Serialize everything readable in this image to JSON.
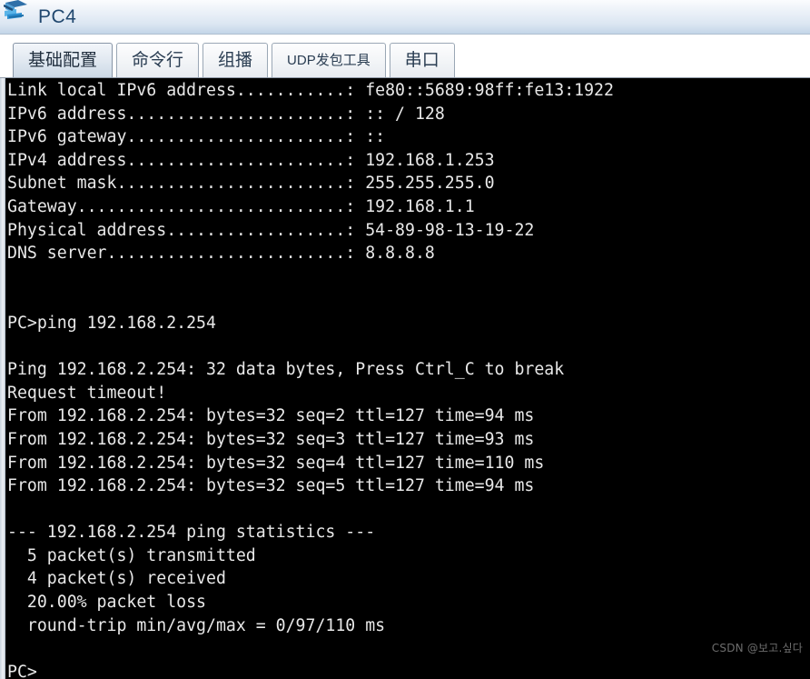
{
  "window": {
    "title": "PC4",
    "icon": "pc-device-icon"
  },
  "tabs": [
    {
      "label": "基础配置",
      "active": true,
      "small": false,
      "name": "tab-basic-config"
    },
    {
      "label": "命令行",
      "active": false,
      "small": false,
      "name": "tab-command-line"
    },
    {
      "label": "组播",
      "active": false,
      "small": false,
      "name": "tab-multicast"
    },
    {
      "label": "UDP发包工具",
      "active": false,
      "small": true,
      "name": "tab-udp-packet-tool"
    },
    {
      "label": "串口",
      "active": false,
      "small": false,
      "name": "tab-serial-port"
    }
  ],
  "terminal": {
    "prompt": "PC>",
    "lines": [
      "Link local IPv6 address...........: fe80::5689:98ff:fe13:1922",
      "IPv6 address......................: :: / 128",
      "IPv6 gateway......................: ::",
      "IPv4 address......................: 192.168.1.253",
      "Subnet mask.......................: 255.255.255.0",
      "Gateway...........................: 192.168.1.1",
      "Physical address..................: 54-89-98-13-19-22",
      "DNS server........................: 8.8.8.8",
      "",
      "",
      "PC>ping 192.168.2.254",
      "",
      "Ping 192.168.2.254: 32 data bytes, Press Ctrl_C to break",
      "Request timeout!",
      "From 192.168.2.254: bytes=32 seq=2 ttl=127 time=94 ms",
      "From 192.168.2.254: bytes=32 seq=3 ttl=127 time=93 ms",
      "From 192.168.2.254: bytes=32 seq=4 ttl=127 time=110 ms",
      "From 192.168.2.254: bytes=32 seq=5 ttl=127 time=94 ms",
      "",
      "--- 192.168.2.254 ping statistics ---",
      "  5 packet(s) transmitted",
      "  4 packet(s) received",
      "  20.00% packet loss",
      "  round-trip min/avg/max = 0/97/110 ms",
      "",
      "PC>"
    ],
    "config": {
      "link_local_ipv6": "fe80::5689:98ff:fe13:1922",
      "ipv6_address": ":: / 128",
      "ipv6_gateway": "::",
      "ipv4_address": "192.168.1.253",
      "subnet_mask": "255.255.255.0",
      "gateway": "192.168.1.1",
      "physical_address": "54-89-98-13-19-22",
      "dns_server": "8.8.8.8"
    },
    "ping": {
      "command": "ping 192.168.2.254",
      "target": "192.168.2.254",
      "data_bytes": "32",
      "break_hint": "Press Ctrl_C to break",
      "timeout_message": "Request timeout!",
      "replies": [
        {
          "seq": "2",
          "ttl": "127",
          "time": "94",
          "bytes": "32"
        },
        {
          "seq": "3",
          "ttl": "127",
          "time": "93",
          "bytes": "32"
        },
        {
          "seq": "4",
          "ttl": "127",
          "time": "110",
          "bytes": "32"
        },
        {
          "seq": "5",
          "ttl": "127",
          "time": "94",
          "bytes": "32"
        }
      ],
      "statistics": {
        "transmitted": "5 packet(s) transmitted",
        "received": "4 packet(s) received",
        "loss": "20.00% packet loss",
        "round_trip": "round-trip min/avg/max = 0/97/110 ms"
      }
    }
  },
  "watermark": {
    "text": "CSDN @보고.싶다"
  },
  "colors": {
    "terminal_bg": "#000000",
    "terminal_fg": "#e8e8e8",
    "titlebar_top": "#fbfcfe",
    "titlebar_bottom": "#c3d5e8",
    "title_text": "#20476e",
    "tab_active_bg": "#dfe7f0",
    "watermark": "#6d6d6d"
  }
}
